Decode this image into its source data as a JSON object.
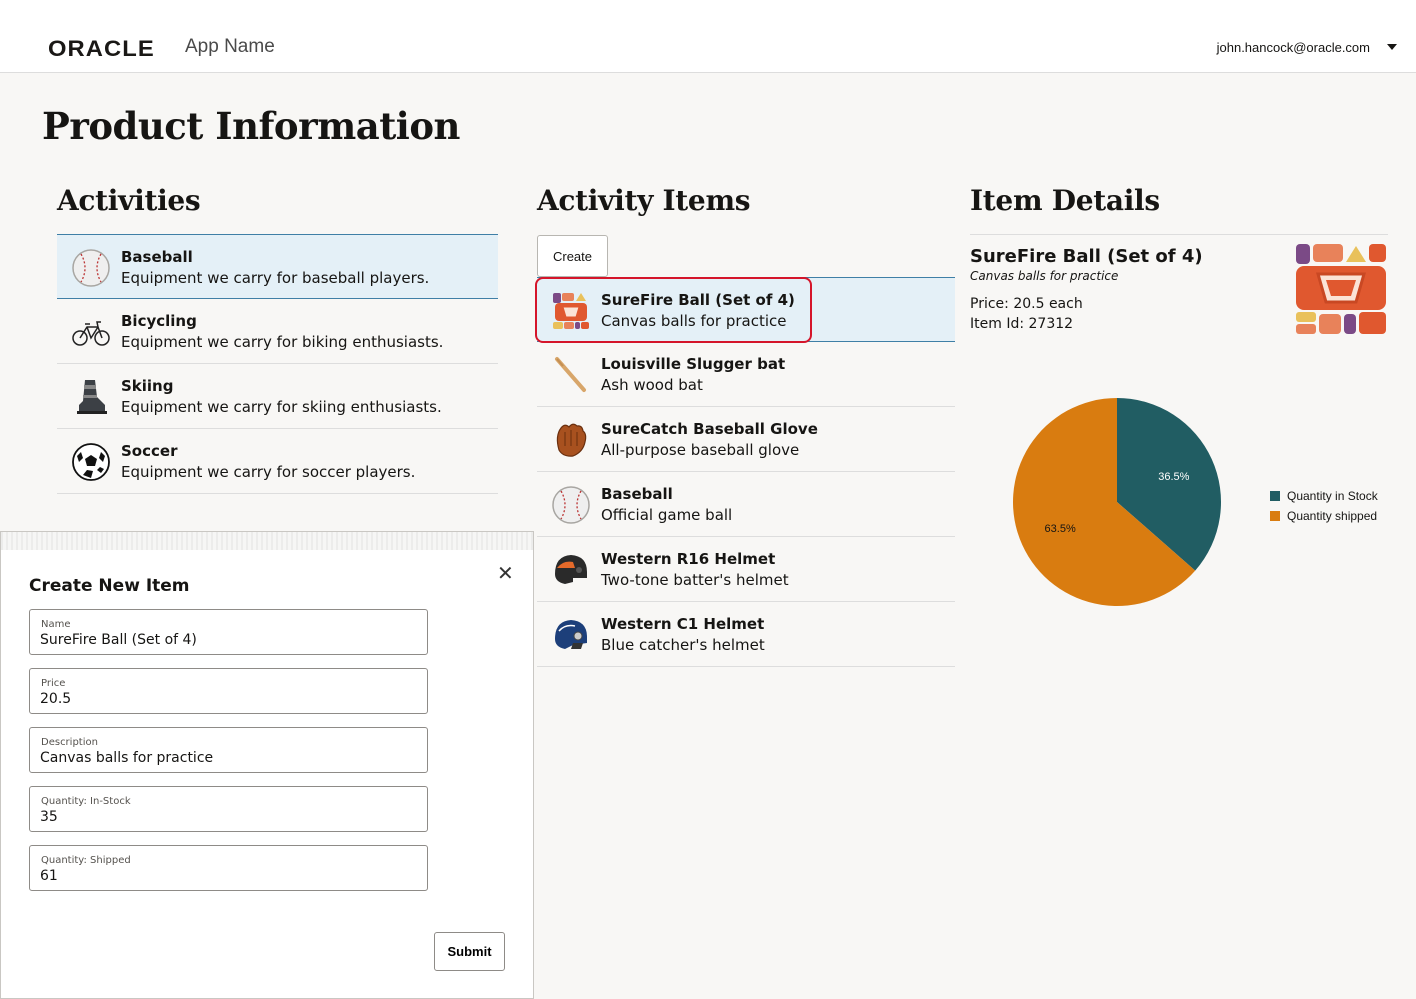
{
  "header": {
    "logo_text": "ORACLE",
    "app_name": "App Name",
    "user_email": "john.hancock@oracle.com"
  },
  "page_title": "Product Information",
  "activities": {
    "heading": "Activities",
    "items": [
      {
        "name": "Baseball",
        "desc": "Equipment we carry for baseball players.",
        "icon": "baseball-icon"
      },
      {
        "name": "Bicycling",
        "desc": "Equipment we carry for biking enthusiasts.",
        "icon": "bicycle-icon"
      },
      {
        "name": "Skiing",
        "desc": "Equipment we carry for skiing enthusiasts.",
        "icon": "ski-boot-icon"
      },
      {
        "name": "Soccer",
        "desc": "Equipment we carry for soccer players.",
        "icon": "soccer-ball-icon"
      }
    ],
    "selected_index": 0
  },
  "activity_items": {
    "heading": "Activity Items",
    "create_label": "Create",
    "items": [
      {
        "name": "SureFire Ball (Set of 4)",
        "desc": "Canvas balls for practice",
        "icon": "canvas-balls-icon"
      },
      {
        "name": "Louisville Slugger bat",
        "desc": "Ash wood bat",
        "icon": "bat-icon"
      },
      {
        "name": "SureCatch Baseball Glove",
        "desc": "All-purpose baseball glove",
        "icon": "glove-icon"
      },
      {
        "name": "Baseball",
        "desc": "Official game ball",
        "icon": "baseball-icon"
      },
      {
        "name": "Western R16 Helmet",
        "desc": "Two-tone batter's helmet",
        "icon": "helmet-icon"
      },
      {
        "name": "Western C1 Helmet",
        "desc": "Blue catcher's helmet",
        "icon": "catcher-helmet-icon"
      }
    ],
    "selected_index": 0
  },
  "item_details": {
    "heading": "Item Details",
    "name": "SureFire Ball (Set of 4)",
    "desc": "Canvas balls for practice",
    "price": "Price: 20.5 each",
    "item_id": "Item Id: 27312"
  },
  "chart_data": {
    "type": "pie",
    "series": [
      {
        "name": "Quantity in Stock",
        "value": 35,
        "label": "36.5%",
        "color": "#215d63"
      },
      {
        "name": "Quantity shipped",
        "value": 61,
        "label": "63.5%",
        "color": "#d97c10"
      }
    ],
    "legend": "right"
  },
  "dialog": {
    "title": "Create New Item",
    "fields": [
      {
        "label": "Name",
        "value": "SureFire Ball (Set of 4)"
      },
      {
        "label": "Price",
        "value": "20.5"
      },
      {
        "label": "Description",
        "value": "Canvas balls for practice"
      },
      {
        "label": "Quantity: In-Stock",
        "value": "35"
      },
      {
        "label": "Quantity: Shipped",
        "value": "61"
      }
    ],
    "submit_label": "Submit",
    "close_glyph": "✕"
  },
  "colors": {
    "selected_bg": "#e4f0f7",
    "selected_border": "#3f7fa6",
    "highlight_border": "#d5152a"
  }
}
